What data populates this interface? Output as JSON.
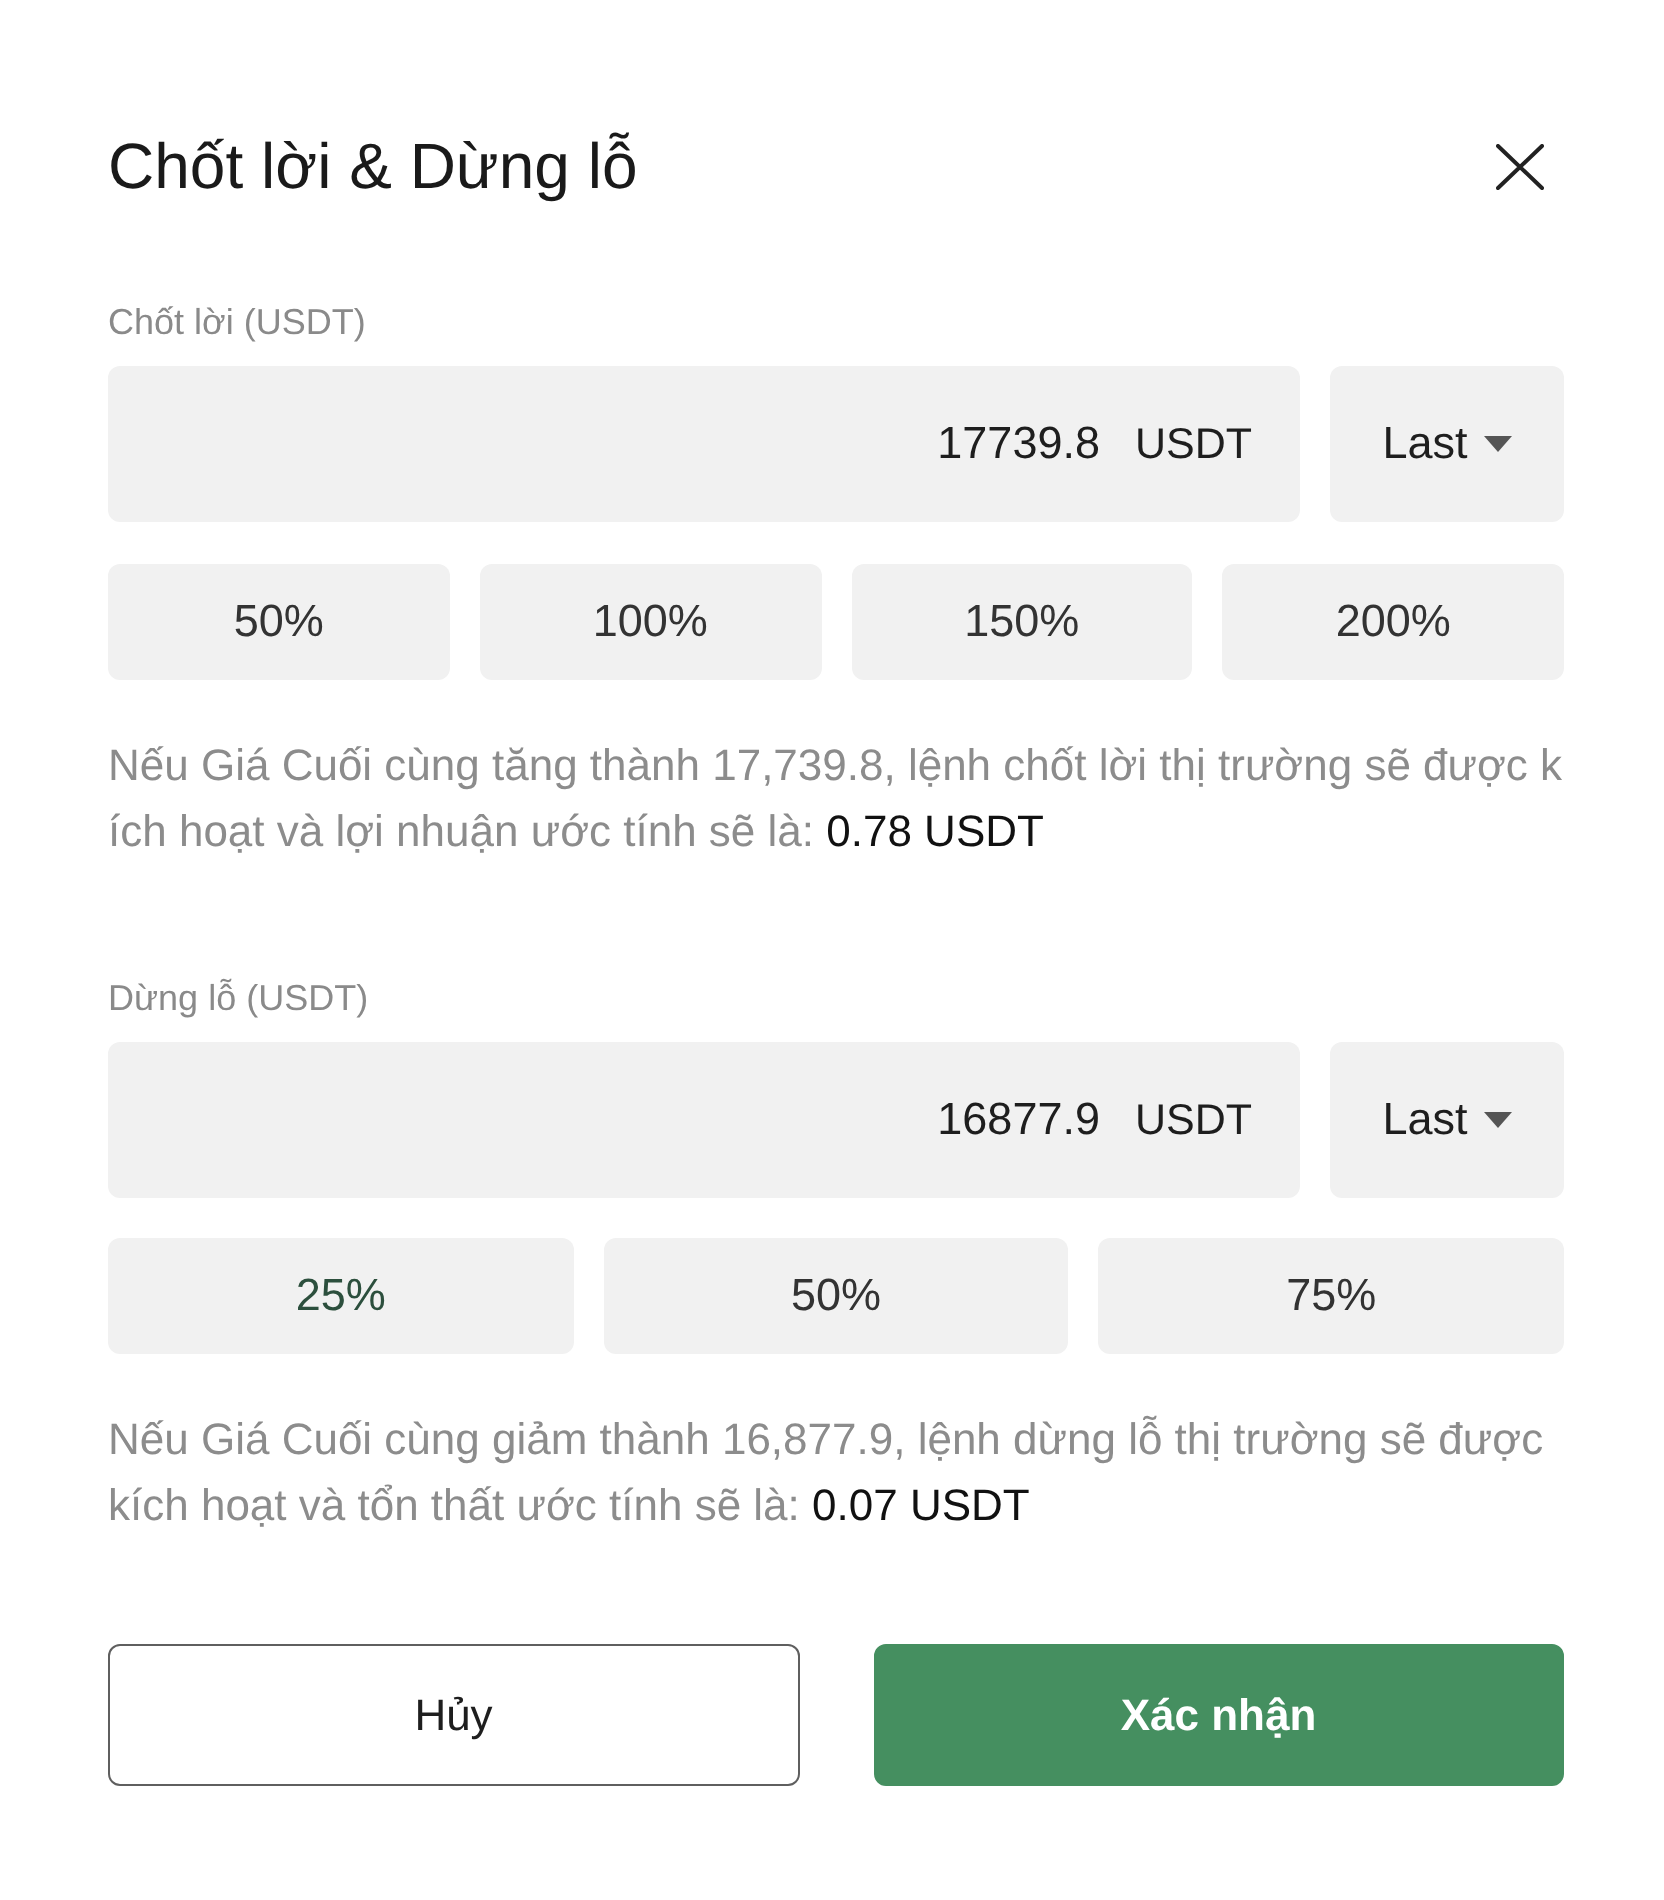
{
  "dialog": {
    "title": "Chốt lời & Dừng lỗ"
  },
  "take_profit": {
    "label": "Chốt lời (USDT)",
    "value": "17739.8",
    "unit": "USDT",
    "trigger": "Last",
    "presets": [
      {
        "label": "50%",
        "selected": false
      },
      {
        "label": "100%",
        "selected": false
      },
      {
        "label": "150%",
        "selected": false
      },
      {
        "label": "200%",
        "selected": false
      }
    ],
    "hint": "Nếu Giá Cuối cùng tăng thành 17,739.8, lệnh chốt lời thị trường sẽ được kích hoạt và lợi nhuận ước tính sẽ là: **0.78 USDT**"
  },
  "stop_loss": {
    "label": "Dừng lỗ (USDT)",
    "value": "16877.9",
    "unit": "USDT",
    "trigger": "Last",
    "presets": [
      {
        "label": "25%",
        "selected": true
      },
      {
        "label": "50%",
        "selected": false
      },
      {
        "label": "75%",
        "selected": false
      }
    ],
    "hint": "Nếu Giá Cuối cùng giảm thành 16,877.9, lệnh dừng lỗ thị trường sẽ được kích hoạt và tổn thất ước tính sẽ là: **0.07 USDT**"
  },
  "buttons": [
    {
      "label": "Hủy",
      "kind": "secondary"
    },
    {
      "label": "Xác nhận",
      "kind": "primary"
    }
  ]
}
